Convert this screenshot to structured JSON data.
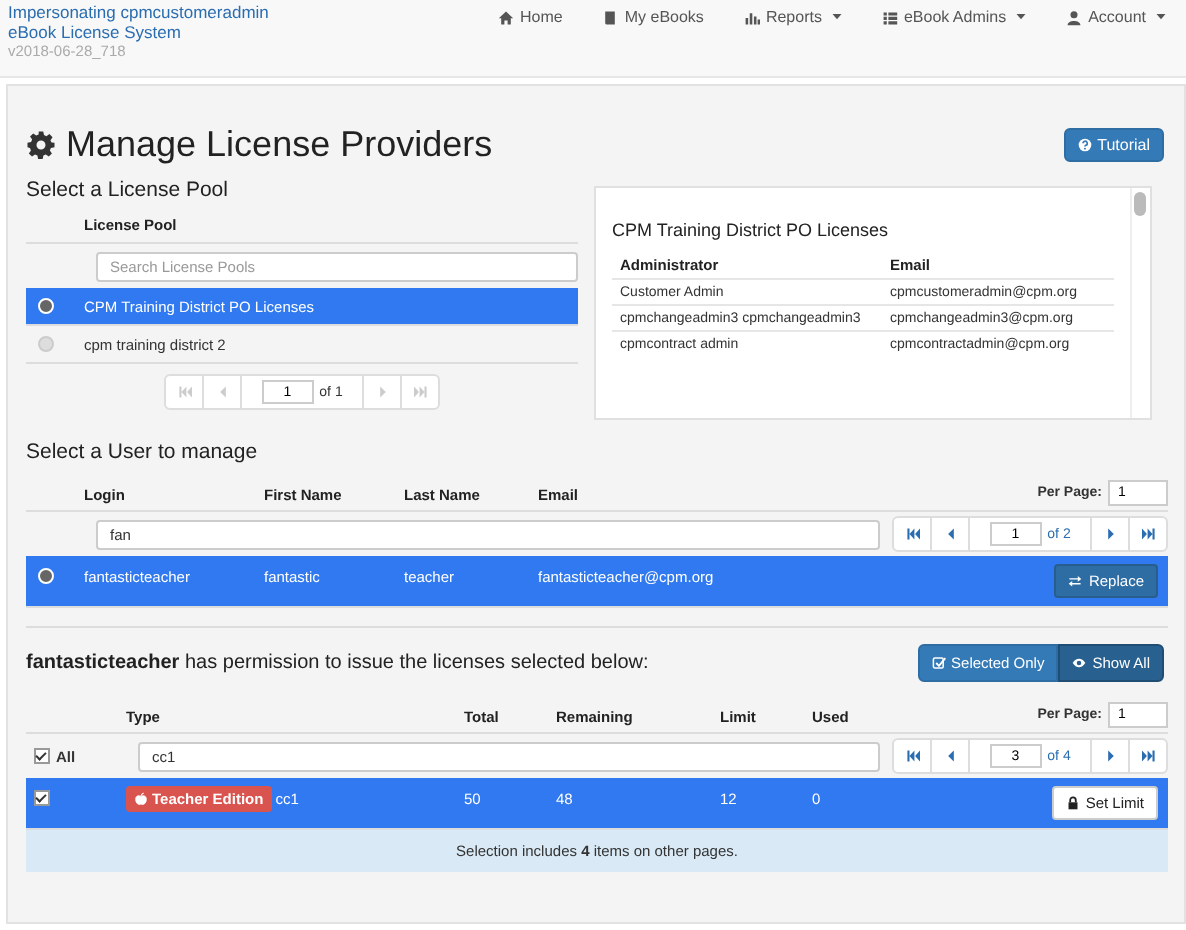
{
  "brand": {
    "impersonating": "Impersonating cpmcustomeradmin",
    "system": "eBook License System",
    "version": "v2018-06-28_718"
  },
  "nav": [
    {
      "label": "Home",
      "kind": "home",
      "caret": false
    },
    {
      "label": "My eBooks",
      "kind": "book",
      "caret": false
    },
    {
      "label": "Reports",
      "kind": "chart",
      "caret": true
    },
    {
      "label": "eBook Admins",
      "kind": "list",
      "caret": true
    },
    {
      "label": "Account",
      "kind": "user",
      "caret": true
    }
  ],
  "page": {
    "title": "Manage License Providers",
    "tutorial": "Tutorial"
  },
  "pools": {
    "heading": "Select a License Pool",
    "column": "License Pool",
    "placeholder": "Search License Pools",
    "rows": [
      {
        "name": "CPM Training District PO Licenses",
        "selected": true
      },
      {
        "name": "cpm training district 2",
        "selected": false
      }
    ],
    "pager": {
      "page": "1",
      "of": "of 1",
      "disabled": true
    }
  },
  "admins": {
    "title": "CPM Training District PO Licenses",
    "columns": [
      "Administrator",
      "Email"
    ],
    "rows": [
      [
        "Customer Admin",
        "cpmcustomeradmin@cpm.org"
      ],
      [
        "cpmchangeadmin3 cpmchangeadmin3",
        "cpmchangeadmin3@cpm.org"
      ],
      [
        "cpmcontract admin",
        "cpmcontractadmin@cpm.org"
      ]
    ]
  },
  "users": {
    "heading": "Select a User to manage",
    "columns": [
      "Login",
      "First Name",
      "Last Name",
      "Email"
    ],
    "per_page_label": "Per Page:",
    "per_page": "1",
    "filter": "fan",
    "pager": {
      "page": "1",
      "of": "of 2",
      "disabled": false
    },
    "rows": [
      {
        "login": "fantasticteacher",
        "first": "fantastic",
        "last": "teacher",
        "email": "fantasticteacher@cpm.org",
        "selected": true
      }
    ],
    "replace": "Replace"
  },
  "licenses": {
    "heading": "**fantasticteacher** has permission to issue the licenses selected below:",
    "toggles": [
      {
        "label": "Selected Only",
        "kind": "check",
        "selected": false
      },
      {
        "label": "Show All",
        "kind": "eye",
        "selected": true
      }
    ],
    "columns": [
      "Type",
      "Total",
      "Remaining",
      "Limit",
      "Used"
    ],
    "per_page_label": "Per Page:",
    "per_page": "1",
    "all": {
      "label": "All",
      "checked": true
    },
    "filter": "cc1",
    "pager": {
      "page": "3",
      "of": "of 4",
      "disabled": false
    },
    "rows": [
      {
        "checked": true,
        "badge": "Teacher Edition",
        "type": "cc1",
        "total": "50",
        "remaining": "48",
        "limit": "12",
        "used": "0"
      }
    ],
    "set_limit": "Set Limit",
    "note": "Selection includes **4** items on other pages."
  }
}
